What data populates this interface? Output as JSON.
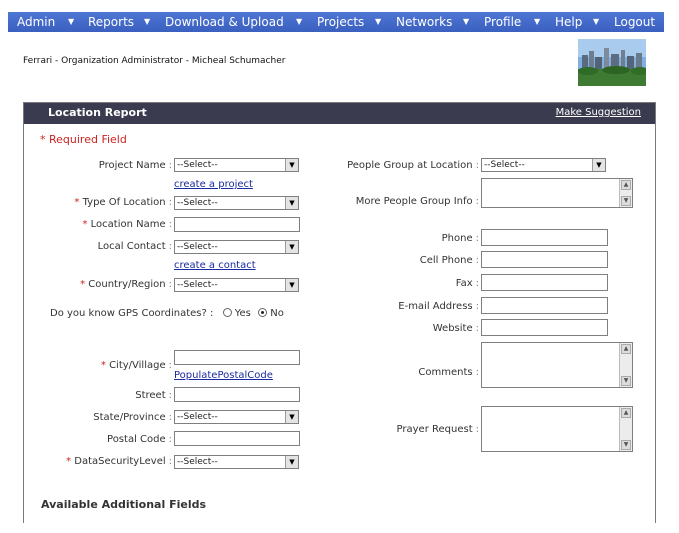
{
  "nav": {
    "items": [
      "Admin",
      "Reports",
      "Download & Upload",
      "Projects",
      "Networks",
      "Profile",
      "Help",
      "Logout"
    ]
  },
  "user_line": "Ferrari - Organization Administrator - Micheal Schumacher",
  "panel": {
    "title": "Location Report",
    "make_suggestion": "Make Suggestion",
    "required_note": "* Required Field"
  },
  "form_left": {
    "project_name": {
      "label": "Project Name",
      "value": "--Select--",
      "link": "create a project"
    },
    "type_of_location": {
      "label": "Type Of Location",
      "value": "--Select--",
      "required": "*"
    },
    "location_name": {
      "label": "Location Name",
      "required": "*"
    },
    "local_contact": {
      "label": "Local Contact",
      "value": "--Select--",
      "link": "create a contact"
    },
    "country_region": {
      "label": "Country/Region",
      "value": "--Select--",
      "required": "*"
    },
    "gps": {
      "question": "Do you know GPS Coordinates? :",
      "yes": "Yes",
      "no": "No"
    },
    "city_village": {
      "label": "City/Village",
      "required": "*",
      "link": "PopulatePostalCode"
    },
    "street": {
      "label": "Street"
    },
    "state_province": {
      "label": "State/Province",
      "value": "--Select--"
    },
    "postal_code": {
      "label": "Postal Code"
    },
    "data_security_level": {
      "label": "DataSecurityLevel",
      "value": "--Select--",
      "required": "*"
    }
  },
  "form_right": {
    "people_group": {
      "label": "People Group at Location",
      "value": "--Select--"
    },
    "more_people_group": {
      "label": "More People Group Info"
    },
    "phone": {
      "label": "Phone"
    },
    "cell_phone": {
      "label": "Cell Phone"
    },
    "fax": {
      "label": "Fax"
    },
    "email": {
      "label": "E-mail Address"
    },
    "website": {
      "label": "Website"
    },
    "comments": {
      "label": "Comments"
    },
    "prayer_request": {
      "label": "Prayer Request"
    }
  },
  "additional_fields": "Available Additional Fields",
  "colors": {
    "nav_bg": "#3d63c6",
    "panel_bar": "#3b3b50",
    "required": "#cc2222",
    "link": "#1a2aa0"
  }
}
